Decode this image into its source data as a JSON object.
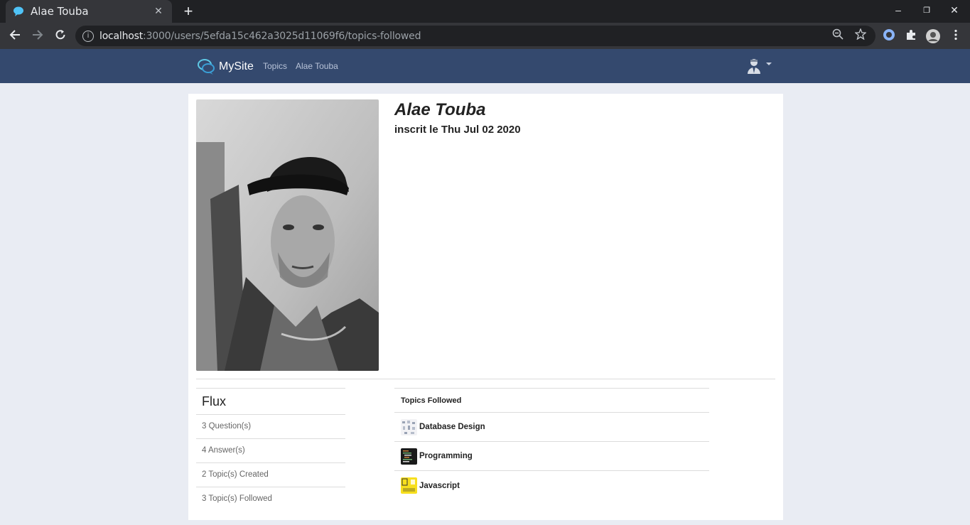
{
  "browser": {
    "tab_title": "Alae Touba",
    "tab_close": "✕",
    "new_tab": "+",
    "url_host": "localhost",
    "url_rest": ":3000/users/5efda15c462a3025d11069f6/topics-followed",
    "window": {
      "minimize": "–",
      "restore": "❐",
      "close": "✕"
    },
    "icons": [
      "back-arrow-icon",
      "forward-arrow-icon",
      "reload-icon",
      "info-icon",
      "zoom-icon",
      "star-icon",
      "extension-icon",
      "puzzle-icon",
      "profile-icon",
      "menu-icon"
    ]
  },
  "navbar": {
    "brand": "MySite",
    "links": [
      "Topics",
      "Alae Touba"
    ],
    "user_icon": "user-avatar-icon"
  },
  "profile": {
    "name": "Alae Touba",
    "joined": "inscrit le Thu Jul 02 2020"
  },
  "flux": {
    "title": "Flux",
    "items": [
      "3 Question(s)",
      "4 Answer(s)",
      "2 Topic(s) Created",
      "3 Topic(s) Followed"
    ]
  },
  "topics": {
    "title": "Topics Followed",
    "items": [
      {
        "name": "Database Design",
        "thumb_color": "#e8e8ee"
      },
      {
        "name": "Programming",
        "thumb_color": "#1a1a1a"
      },
      {
        "name": "Javascript",
        "thumb_color": "#f7df1e"
      }
    ]
  },
  "colors": {
    "navbar": "#34496e",
    "page_bg": "#e9ecf3",
    "chrome_dark": "#202124",
    "chrome_toolbar": "#35363a"
  }
}
